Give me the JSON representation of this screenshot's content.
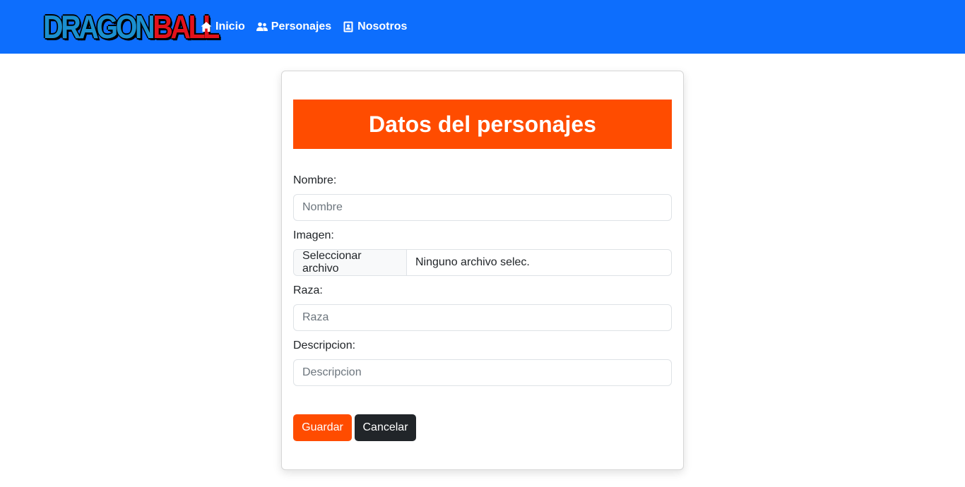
{
  "navbar": {
    "logo": {
      "part1": "DRAGON",
      "part2": "BALL"
    },
    "links": [
      {
        "label": "Inicio",
        "icon": "home-icon"
      },
      {
        "label": "Personajes",
        "icon": "users-icon"
      },
      {
        "label": "Nosotros",
        "icon": "id-badge-icon"
      }
    ],
    "color": "#0d6efd"
  },
  "form": {
    "title": "Datos del personajes",
    "title_color": "#ff4c00",
    "nombre": {
      "label": "Nombre:",
      "placeholder": "Nombre",
      "value": ""
    },
    "imagen": {
      "label": "Imagen:",
      "button_label": "Seleccionar archivo",
      "file_text": "Ninguno archivo selec."
    },
    "raza": {
      "label": "Raza:",
      "placeholder": "Raza",
      "value": ""
    },
    "descripcion": {
      "label": "Descripcion:",
      "placeholder": "Descripcion",
      "value": ""
    },
    "save_label": "Guardar",
    "cancel_label": "Cancelar"
  }
}
